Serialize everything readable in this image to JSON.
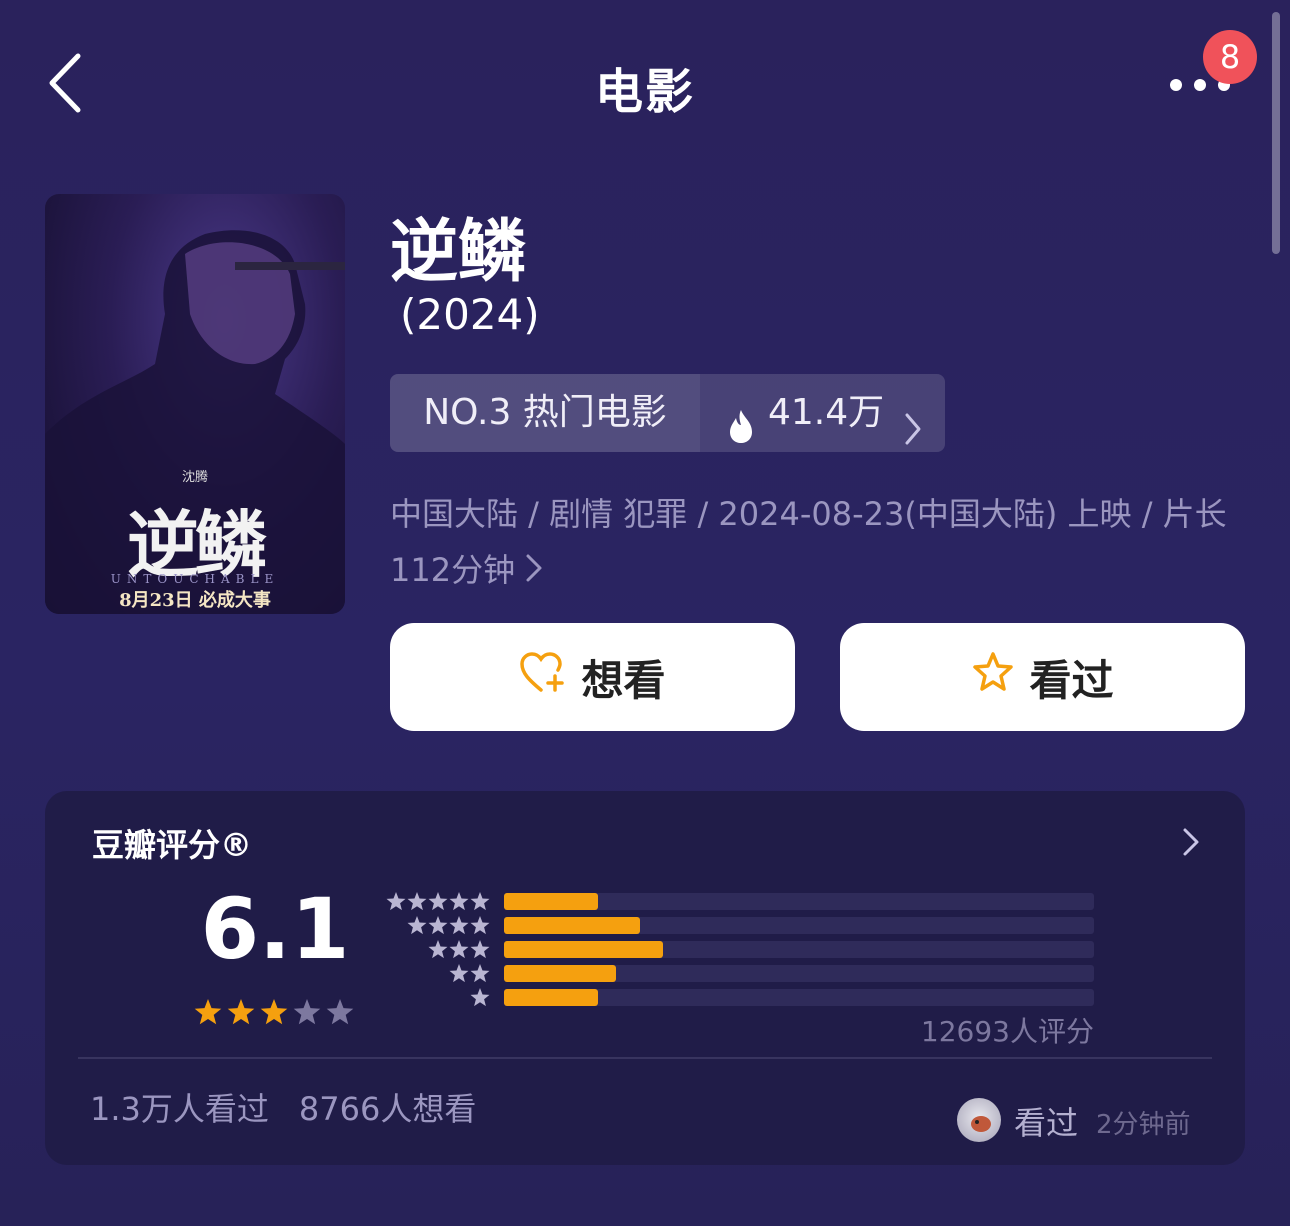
{
  "header": {
    "title": "电影",
    "badge_count": "8"
  },
  "poster": {
    "title_text": "逆鳞",
    "subtitle_text": "UNTOUCHABLE",
    "date_text": "8月23日 必成大事",
    "actor_text": "沈腾"
  },
  "movie": {
    "title": "逆鳞",
    "year": "(2024)",
    "rank_label": "NO.3 热门电影",
    "heat_value": "41.4万",
    "meta_line": "中国大陆 / 剧情 犯罪 / 2024-08-23(中国大陆) 上映 / 片长112分钟"
  },
  "actions": {
    "want_label": "想看",
    "seen_label": "看过"
  },
  "rating": {
    "section_title": "豆瓣评分®",
    "score": "6.1",
    "score_stars": 3,
    "distribution": [
      {
        "stars": 5,
        "fraction": 0.16
      },
      {
        "stars": 4,
        "fraction": 0.23
      },
      {
        "stars": 3,
        "fraction": 0.27
      },
      {
        "stars": 2,
        "fraction": 0.19
      },
      {
        "stars": 1,
        "fraction": 0.16
      }
    ],
    "rating_count": "12693人评分",
    "watched_count": "1.3万人看过",
    "want_count": "8766人想看",
    "recent_action": "看过",
    "recent_time": "2分钟前"
  },
  "colors": {
    "background": "#2a225c",
    "card": "#201c48",
    "bar": "#f5a00f",
    "star_on": "#f5a00f",
    "star_off": "#7d789f",
    "badge": "#f0525a"
  }
}
